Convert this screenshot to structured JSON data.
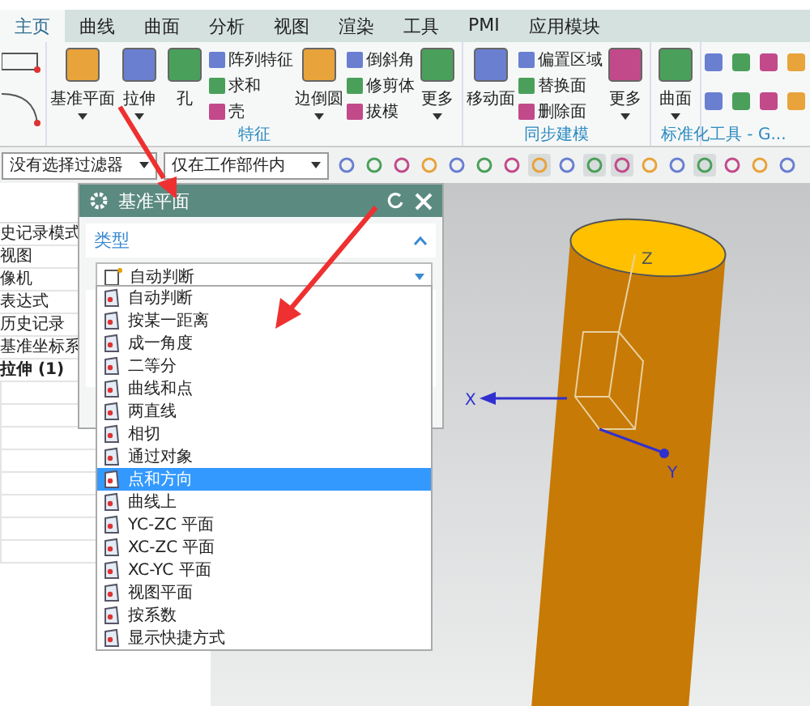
{
  "tabs": [
    {
      "label": "主页",
      "selected": true
    },
    {
      "label": "曲线",
      "selected": false
    },
    {
      "label": "曲面",
      "selected": false
    },
    {
      "label": "分析",
      "selected": false
    },
    {
      "label": "视图",
      "selected": false
    },
    {
      "label": "渲染",
      "selected": false
    },
    {
      "label": "工具",
      "selected": false
    },
    {
      "label": "PMI",
      "selected": false
    },
    {
      "label": "应用模块",
      "selected": false
    }
  ],
  "ribbon": {
    "groups": [
      {
        "title": "特征",
        "columns": [
          {
            "kind": "large",
            "label": "基准平面",
            "dropdown": true
          },
          {
            "kind": "large",
            "label": "拉伸",
            "dropdown": true
          },
          {
            "kind": "large",
            "label": "孔",
            "dropdown": false
          },
          {
            "kind": "stack",
            "items": [
              "阵列特征",
              "求和",
              "壳"
            ]
          },
          {
            "kind": "large",
            "label": "边倒圆",
            "dropdown": true
          },
          {
            "kind": "stack",
            "items": [
              "倒斜角",
              "修剪体",
              "拔模"
            ]
          },
          {
            "kind": "large",
            "label": "更多",
            "dropdown": true
          }
        ]
      },
      {
        "title": "同步建模",
        "columns": [
          {
            "kind": "large",
            "label": "移动面",
            "dropdown": false
          },
          {
            "kind": "stack",
            "items": [
              "偏置区域",
              "替换面",
              "删除面"
            ]
          },
          {
            "kind": "large",
            "label": "更多",
            "dropdown": true
          }
        ]
      },
      {
        "columns": [
          {
            "kind": "large",
            "label": "曲面",
            "dropdown": true
          }
        ]
      },
      {
        "title": "标准化工具 - G...",
        "columns": [
          {
            "kind": "grid"
          }
        ]
      }
    ]
  },
  "filters": [
    "没有选择过滤器",
    "仅在工作部件内"
  ],
  "navigator": {
    "rows": [
      "史记录模式",
      "视图",
      "像机",
      "表达式",
      "历史记录",
      "基准坐标系",
      "拉伸 (1)"
    ]
  },
  "dialog": {
    "title": "基准平面",
    "section": "类型",
    "combo_value": "自动判断",
    "options": [
      {
        "label": "自动判断",
        "selected": false
      },
      {
        "label": "按某一距离",
        "selected": false
      },
      {
        "label": "成一角度",
        "selected": false
      },
      {
        "label": "二等分",
        "selected": false
      },
      {
        "label": "曲线和点",
        "selected": false
      },
      {
        "label": "两直线",
        "selected": false
      },
      {
        "label": "相切",
        "selected": false
      },
      {
        "label": "通过对象",
        "selected": false
      },
      {
        "label": "点和方向",
        "selected": true
      },
      {
        "label": "曲线上",
        "selected": false
      },
      {
        "label": "YC-ZC 平面",
        "selected": false
      },
      {
        "label": "XC-ZC 平面",
        "selected": false
      },
      {
        "label": "XC-YC 平面",
        "selected": false
      },
      {
        "label": "视图平面",
        "selected": false
      },
      {
        "label": "按系数",
        "selected": false
      },
      {
        "label": "显示快捷方式",
        "selected": false
      }
    ]
  },
  "viewport": {
    "axes": [
      "X",
      "Y",
      "Z"
    ]
  }
}
